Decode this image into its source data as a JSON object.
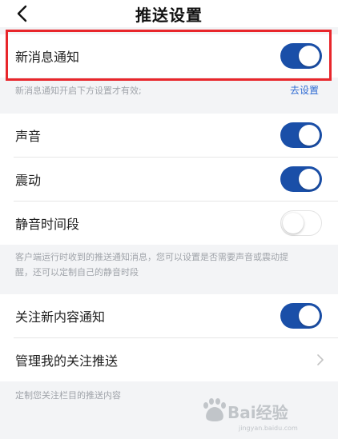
{
  "header": {
    "title": "推送设置",
    "back_icon": "chevron-left-icon"
  },
  "notify": {
    "label": "新消息通知",
    "enabled": true,
    "hint": "新消息通知开启下方设置才有效;",
    "link": "去设置"
  },
  "sound_group": {
    "items": [
      {
        "label": "声音",
        "enabled": true
      },
      {
        "label": "震动",
        "enabled": true
      },
      {
        "label": "静音时间段",
        "enabled": false
      }
    ],
    "hint_lines": [
      "客户端运行时收到的推送通知消息，您可以设置是否需要声音或震动提",
      "醒，还可以定制自己的静音时段"
    ]
  },
  "follow_group": {
    "follow_label": "关注新内容通知",
    "follow_enabled": true,
    "manage_label": "管理我的关注推送",
    "hint": "定制您关注栏目的推送内容"
  },
  "watermark": {
    "text": "Bai经验",
    "sub": "jingyan.baidu.com"
  },
  "colors": {
    "toggle_on": "#1a4fa8",
    "link": "#2f6bd3",
    "highlight": "#e8262b"
  }
}
